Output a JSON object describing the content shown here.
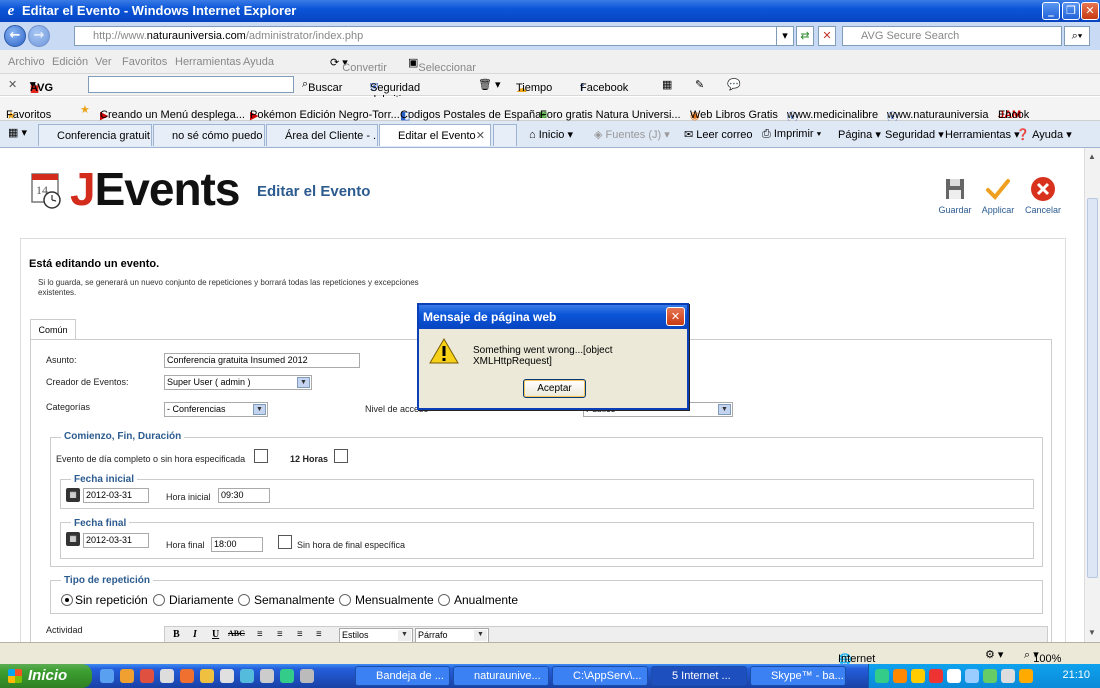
{
  "window": {
    "title": "Editar el Evento - Windows Internet Explorer",
    "url_prefix": "http://www.",
    "url_domain": "naturauniversia.com",
    "url_path": "/administrator/index.php",
    "search_placeholder": "AVG Secure Search"
  },
  "menu": [
    "Archivo",
    "Edición",
    "Ver",
    "Favoritos",
    "Herramientas",
    "Ayuda"
  ],
  "addr_tools": {
    "convertir": "Convertir",
    "seleccionar": "Seleccionar"
  },
  "avgbar": {
    "avg": "AVG",
    "buscar": "Buscar",
    "seguridad": "Seguridad del sitio",
    "tiempo": "Tiempo",
    "facebook": "Facebook"
  },
  "favorites": {
    "label": "Favoritos",
    "items": [
      "Creando un Menú desplega...",
      "Pokémon Edición Negro-Torr...",
      "Codigos Postales de España",
      "Foro gratis  Natura Universi...",
      "Web Libros Gratis",
      "www.medicinalibre",
      "www.naturauniversia",
      "Ebook"
    ]
  },
  "tabs": [
    "Conferencia gratuit...",
    "no sé cómo puedo ...",
    "Área del Cliente - ...",
    "Editar el Evento"
  ],
  "commands": {
    "inicio": "Inicio",
    "fuentes": "Fuentes (J)",
    "leer": "Leer correo",
    "imprimir": "Imprimir",
    "pagina": "Página",
    "seguridad": "Seguridad",
    "herramientas": "Herramientas",
    "ayuda": "Ayuda"
  },
  "page": {
    "logo_date": "14",
    "logo_j": "J",
    "logo_rest": "Events",
    "title": "Editar el Evento",
    "toolbar": {
      "save": "Guardar",
      "apply": "Applicar",
      "cancel": "Cancelar"
    },
    "editing": "Está editando un evento.",
    "note": "Si lo guarda, se generará un nuevo conjunto de repeticiones y borrará todas las repeticiones y excepciones existentes.",
    "tab": "Común",
    "form": {
      "asunto_label": "Asunto:",
      "asunto_value": "Conferencia gratuita Insumed 2012",
      "creador_label": "Creador de Eventos:",
      "creador_value": "Super User ( admin )",
      "categorias_label": "Categorías",
      "categorias_value": "- Conferencias",
      "nivel_label": "Nivel de acceso",
      "nivel_value": "Público",
      "duracion_legend": "Comienzo, Fin, Duración",
      "allday_label": "Evento de día completo o sin hora especificada",
      "doce_horas": "12 Horas",
      "fecha_inicial_legend": "Fecha inicial",
      "fecha_inicial": "2012-03-31",
      "hora_inicial_label": "Hora inicial",
      "hora_inicial": "09:30",
      "fecha_final_legend": "Fecha final",
      "fecha_final": "2012-03-31",
      "hora_final_label": "Hora final",
      "hora_final": "18:00",
      "sin_hora_final": "Sin hora de final específica",
      "repeticion_legend": "Tipo de repetición",
      "rep_options": [
        "Sin repetición",
        "Diariamente",
        "Semanalmente",
        "Mensualmente",
        "Anualmente"
      ],
      "rep_selected": "Sin repetición",
      "actividad_label": "Actividad",
      "editor_styles": "Estilos",
      "editor_format": "Párrafo",
      "editor_buttons": [
        "B",
        "I",
        "U",
        "ABC"
      ]
    }
  },
  "dialog": {
    "title": "Mensaje de página web",
    "message": "Something went wrong...[object XMLHttpRequest]",
    "ok": "Aceptar"
  },
  "statusbar": {
    "zone": "Internet",
    "zoom": "100%"
  },
  "taskbar": {
    "start": "Inicio",
    "tasks": [
      "Bandeja de ...",
      "naturaunive...",
      "C:\\AppServ\\...",
      "5 Internet ...",
      "Skype™ - ba..."
    ],
    "clock": "21:10"
  }
}
